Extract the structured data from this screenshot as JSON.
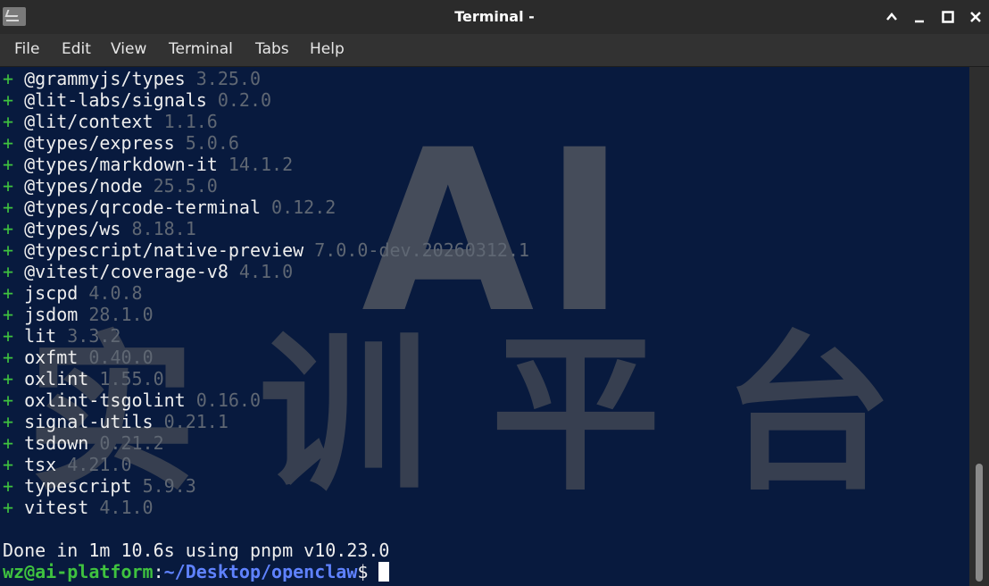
{
  "window": {
    "title": "Terminal -",
    "controls": {
      "maximize_up": "chevron-up-icon",
      "minimize": "minimize-icon",
      "maximize": "maximize-icon",
      "close": "close-icon"
    }
  },
  "menu": {
    "items": [
      "File",
      "Edit",
      "View",
      "Terminal",
      "Tabs",
      "Help"
    ]
  },
  "terminal": {
    "watermark": {
      "top": "AI",
      "bottom": "实训平台"
    },
    "packages": [
      {
        "sign": "+",
        "name": "@grammyjs/types",
        "version": "3.25.0"
      },
      {
        "sign": "+",
        "name": "@lit-labs/signals",
        "version": "0.2.0"
      },
      {
        "sign": "+",
        "name": "@lit/context",
        "version": "1.1.6"
      },
      {
        "sign": "+",
        "name": "@types/express",
        "version": "5.0.6"
      },
      {
        "sign": "+",
        "name": "@types/markdown-it",
        "version": "14.1.2"
      },
      {
        "sign": "+",
        "name": "@types/node",
        "version": "25.5.0"
      },
      {
        "sign": "+",
        "name": "@types/qrcode-terminal",
        "version": "0.12.2"
      },
      {
        "sign": "+",
        "name": "@types/ws",
        "version": "8.18.1"
      },
      {
        "sign": "+",
        "name": "@typescript/native-preview",
        "version": "7.0.0-dev.20260312.1"
      },
      {
        "sign": "+",
        "name": "@vitest/coverage-v8",
        "version": "4.1.0"
      },
      {
        "sign": "+",
        "name": "jscpd",
        "version": "4.0.8"
      },
      {
        "sign": "+",
        "name": "jsdom",
        "version": "28.1.0"
      },
      {
        "sign": "+",
        "name": "lit",
        "version": "3.3.2"
      },
      {
        "sign": "+",
        "name": "oxfmt",
        "version": "0.40.0"
      },
      {
        "sign": "+",
        "name": "oxlint",
        "version": "1.55.0"
      },
      {
        "sign": "+",
        "name": "oxlint-tsgolint",
        "version": "0.16.0"
      },
      {
        "sign": "+",
        "name": "signal-utils",
        "version": "0.21.1"
      },
      {
        "sign": "+",
        "name": "tsdown",
        "version": "0.21.2"
      },
      {
        "sign": "+",
        "name": "tsx",
        "version": "4.21.0"
      },
      {
        "sign": "+",
        "name": "typescript",
        "version": "5.9.3"
      },
      {
        "sign": "+",
        "name": "vitest",
        "version": "4.1.0"
      }
    ],
    "done_line": "Done in 1m 10.6s using pnpm v10.23.0",
    "prompt": {
      "user_host": "wz@ai-platform",
      "colon": ":",
      "path": "~/Desktop/openclaw",
      "symbol": "$"
    }
  },
  "colors": {
    "terminal_bg": "#081a3e",
    "plus_sign": "#3fc23f",
    "package_name": "#eeeeee",
    "version": "#5f6773",
    "prompt_user": "#3fc23f",
    "prompt_path": "#5f82ff",
    "titlebar": "#2b2b2b",
    "menubar": "#323232"
  }
}
